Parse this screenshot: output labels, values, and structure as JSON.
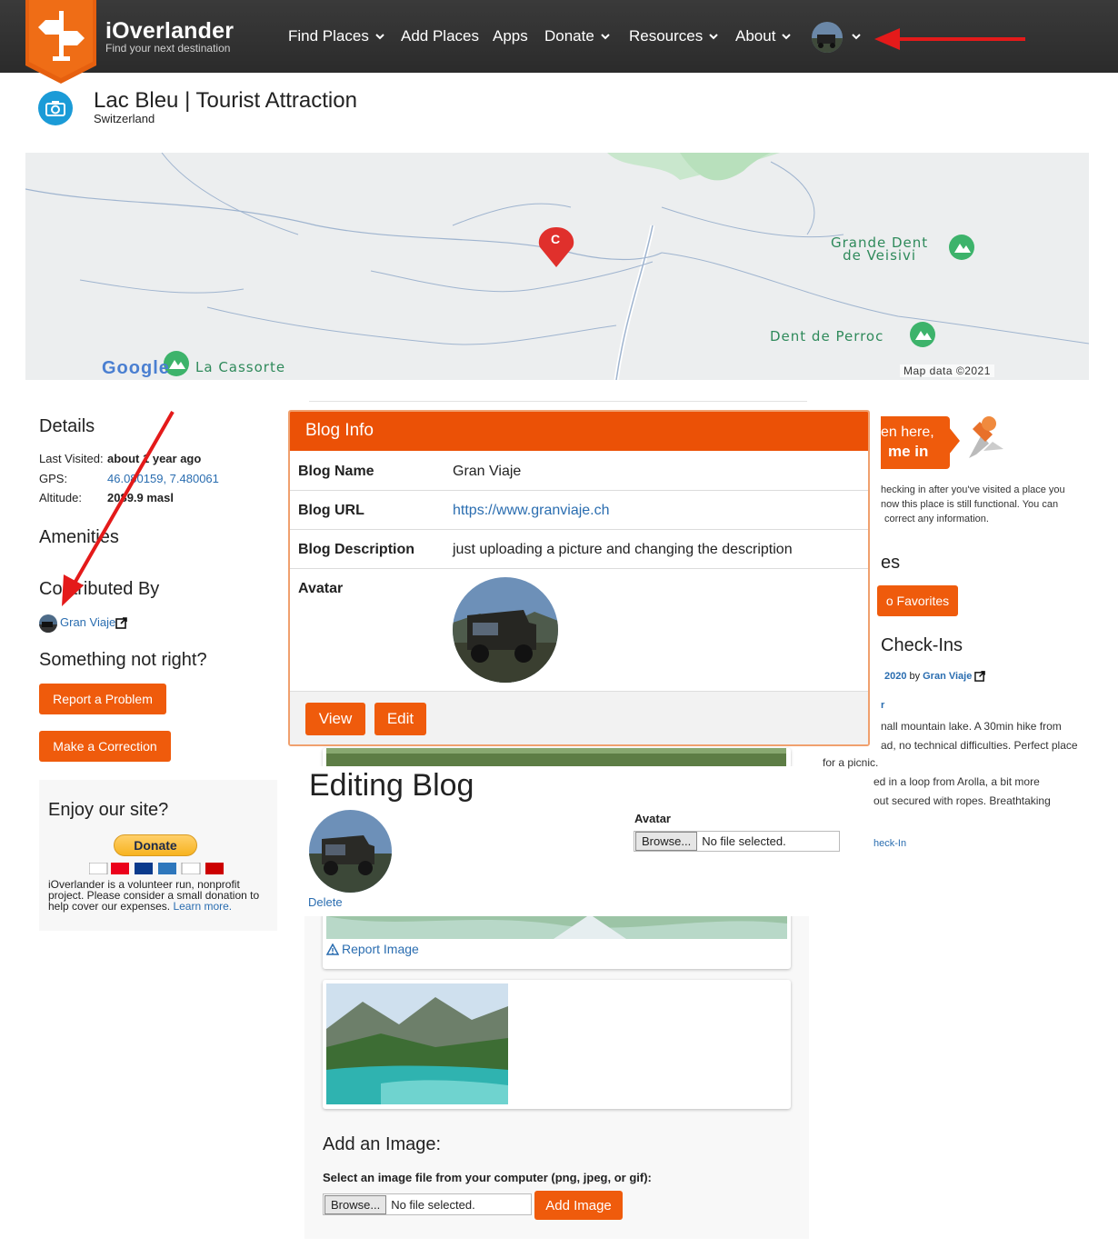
{
  "header": {
    "brand_name": "iOverlander",
    "brand_tagline": "Find your next destination",
    "nav": [
      {
        "label": "Find Places",
        "has_dropdown": true
      },
      {
        "label": "Add Places",
        "has_dropdown": false
      },
      {
        "label": "Apps",
        "has_dropdown": false
      },
      {
        "label": "Donate",
        "has_dropdown": true
      },
      {
        "label": "Resources",
        "has_dropdown": true
      },
      {
        "label": "About",
        "has_dropdown": true
      }
    ]
  },
  "place": {
    "title": "Lac Bleu | Tourist Attraction",
    "country": "Switzerland"
  },
  "map": {
    "labels": [
      "Grande Dent de Veisivi",
      "Dent de Perroc",
      "La Cassorte"
    ],
    "label_line1": "Grande Dent",
    "label_line2": "de Veisivi",
    "label_perroc": "Dent de Perroc",
    "label_cassorte": "La Cassorte",
    "attribution": "Map data ©2021",
    "google": "Google",
    "marker_letter": "C"
  },
  "details": {
    "heading": "Details",
    "last_visited_label": "Last Visited:",
    "last_visited_value": "about 1 year ago",
    "gps_label": "GPS:",
    "gps_value": "46.080159, 7.480061",
    "altitude_label": "Altitude:",
    "altitude_value": "2089.9 masl"
  },
  "amenities": {
    "heading": "Amenities"
  },
  "contributed": {
    "heading": "Contributed By",
    "user": "Gran Viaje"
  },
  "not_right": {
    "heading": "Something not right?",
    "report_button": "Report a Problem",
    "correction_button": "Make a Correction"
  },
  "donate_box": {
    "heading": "Enjoy our site?",
    "button": "Donate",
    "text": "iOverlander is a volunteer run, nonprofit project. Please consider a small donation to help cover our expenses.",
    "learn_more": "Learn more."
  },
  "right_column": {
    "banner_line1": "en here,",
    "banner_line2": "me in",
    "checkin_text": [
      "hecking in after you've visited a place you",
      "now this place is still functional. You can",
      "correct any information."
    ],
    "es_heading": "es",
    "favorites_button": "o Favorites",
    "checkins_heading": "Check-Ins",
    "checkin_meta_date": "2020",
    "checkin_meta_by": "by",
    "checkin_meta_user": "Gran Viaje",
    "checkin_r": "r",
    "checkin_body": [
      "nall mountain lake. A 30min hike from",
      "ad, no technical difficulties. Perfect place",
      "for a picnic.",
      "ed in a loop from Arolla, a bit more",
      "out secured with ropes. Breathtaking"
    ],
    "checkin_link": "heck-In"
  },
  "editing_blog": {
    "heading": "Editing Blog",
    "avatar_label": "Avatar",
    "browse_label": "Browse...",
    "no_file": "No file selected.",
    "delete_link": "Delete"
  },
  "blog_modal": {
    "title": "Blog Info",
    "rows": [
      {
        "key": "Blog Name",
        "value": "Gran Viaje"
      },
      {
        "key": "Blog URL",
        "value": "https://www.granviaje.ch"
      },
      {
        "key": "Blog Description",
        "value": "just uploading a picture and changing the description"
      },
      {
        "key": "Avatar",
        "value": ""
      }
    ],
    "view_button": "View",
    "edit_button": "Edit"
  },
  "gallery": {
    "report_image": "Report Image",
    "add_heading": "Add an Image:",
    "select_label": "Select an image file from your computer (png, jpeg, or gif):",
    "browse_label": "Browse...",
    "no_file": "No file selected.",
    "add_button": "Add Image"
  },
  "colors": {
    "accent": "#eb5106",
    "navbar": "#2e2e2e",
    "link": "#2a6db0",
    "annotation_arrow": "#e41a1a"
  }
}
